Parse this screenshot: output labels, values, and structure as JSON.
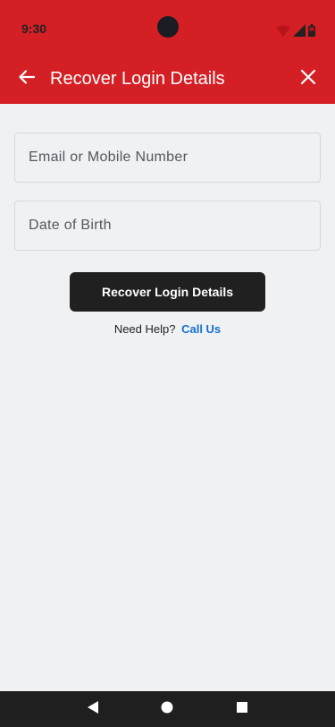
{
  "status_bar": {
    "time": "9:30",
    "icons": [
      "wifi-icon",
      "signal-icon",
      "battery-icon"
    ]
  },
  "app_bar": {
    "title": "Recover Login Details",
    "back_icon": "arrow-left-icon",
    "close_icon": "close-icon",
    "background_color": "#d41f25"
  },
  "form": {
    "email_placeholder": "Email or Mobile Number",
    "email_value": "",
    "dob_placeholder": "Date of Birth",
    "dob_value": "",
    "submit_label": "Recover Login Details"
  },
  "help": {
    "prompt": "Need Help?",
    "link_label": "Call Us",
    "link_color": "#1470d6"
  },
  "nav_bar": {
    "icons": [
      "back-triangle-icon",
      "home-circle-icon",
      "recents-square-icon"
    ]
  }
}
